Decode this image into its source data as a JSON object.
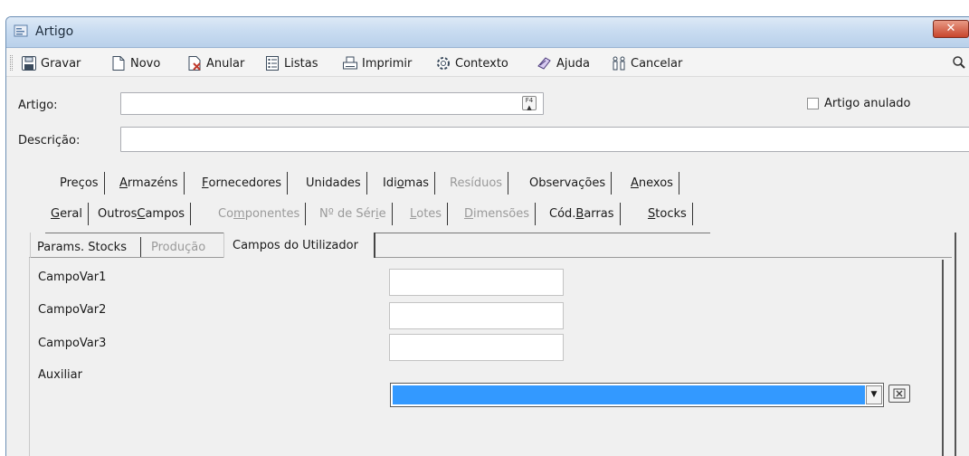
{
  "window": {
    "title": "Artigo",
    "close_glyph": "✕"
  },
  "toolbar": {
    "items": [
      {
        "label": "Gravar",
        "icon": "save-icon"
      },
      {
        "label": "Novo",
        "icon": "new-document-icon"
      },
      {
        "label": "Anular",
        "icon": "void-document-icon"
      },
      {
        "label": "Listas",
        "icon": "list-icon"
      },
      {
        "label": "Imprimir",
        "icon": "printer-icon"
      },
      {
        "label": "Contexto",
        "icon": "context-gear-icon"
      },
      {
        "label": "Ajuda",
        "icon": "help-icon"
      },
      {
        "label": "Cancelar",
        "icon": "cancel-icon"
      }
    ],
    "search_icon": "magnifier-icon"
  },
  "form": {
    "artigo_label": "Artigo:",
    "artigo_value": "",
    "f4_hint": "F4",
    "anulado_label": "Artigo anulado",
    "anulado_checked": false,
    "descricao_label": "Descrição:",
    "descricao_value": ""
  },
  "tabs_row1": [
    {
      "pre": "Preços",
      "u": "",
      "post": "",
      "disabled": false
    },
    {
      "pre": "",
      "u": "A",
      "post": "rmazéns",
      "disabled": false
    },
    {
      "pre": "",
      "u": "F",
      "post": "ornecedores",
      "disabled": false
    },
    {
      "pre": "Unidades",
      "u": "",
      "post": "",
      "disabled": false
    },
    {
      "pre": "Idi",
      "u": "o",
      "post": "mas",
      "disabled": false
    },
    {
      "pre": "Resíduos",
      "u": "",
      "post": "",
      "disabled": true
    },
    {
      "pre": "Observações",
      "u": "",
      "post": "",
      "disabled": false
    },
    {
      "pre": "",
      "u": "A",
      "post": "nexos",
      "disabled": false
    }
  ],
  "tabs_row2": [
    {
      "pre": "",
      "u": "G",
      "post": "eral",
      "disabled": false
    },
    {
      "pre": "Outros ",
      "u": "C",
      "post": "ampos",
      "disabled": false
    },
    {
      "pre": "Co",
      "u": "m",
      "post": "ponentes",
      "disabled": true
    },
    {
      "pre": "Nº de Sér",
      "u": "i",
      "post": "e",
      "disabled": true
    },
    {
      "pre": "",
      "u": "L",
      "post": "otes",
      "disabled": true
    },
    {
      "pre": "",
      "u": "D",
      "post": "imensões",
      "disabled": true
    },
    {
      "pre": "Cód. ",
      "u": "B",
      "post": "arras",
      "disabled": false
    },
    {
      "pre": "",
      "u": "S",
      "post": "tocks",
      "disabled": false
    }
  ],
  "tabs_row3": {
    "params_stocks": "Params. Stocks",
    "producao": "Produção",
    "campos_utilizador": "Campos do Utilizador"
  },
  "user_fields": [
    {
      "label": "CampoVar1",
      "value": ""
    },
    {
      "label": "CampoVar2",
      "value": ""
    },
    {
      "label": "CampoVar3",
      "value": ""
    }
  ],
  "auxiliar": {
    "label": "Auxiliar",
    "value": "",
    "selected_color": "#3399ff",
    "dropdown_glyph": "▼"
  }
}
